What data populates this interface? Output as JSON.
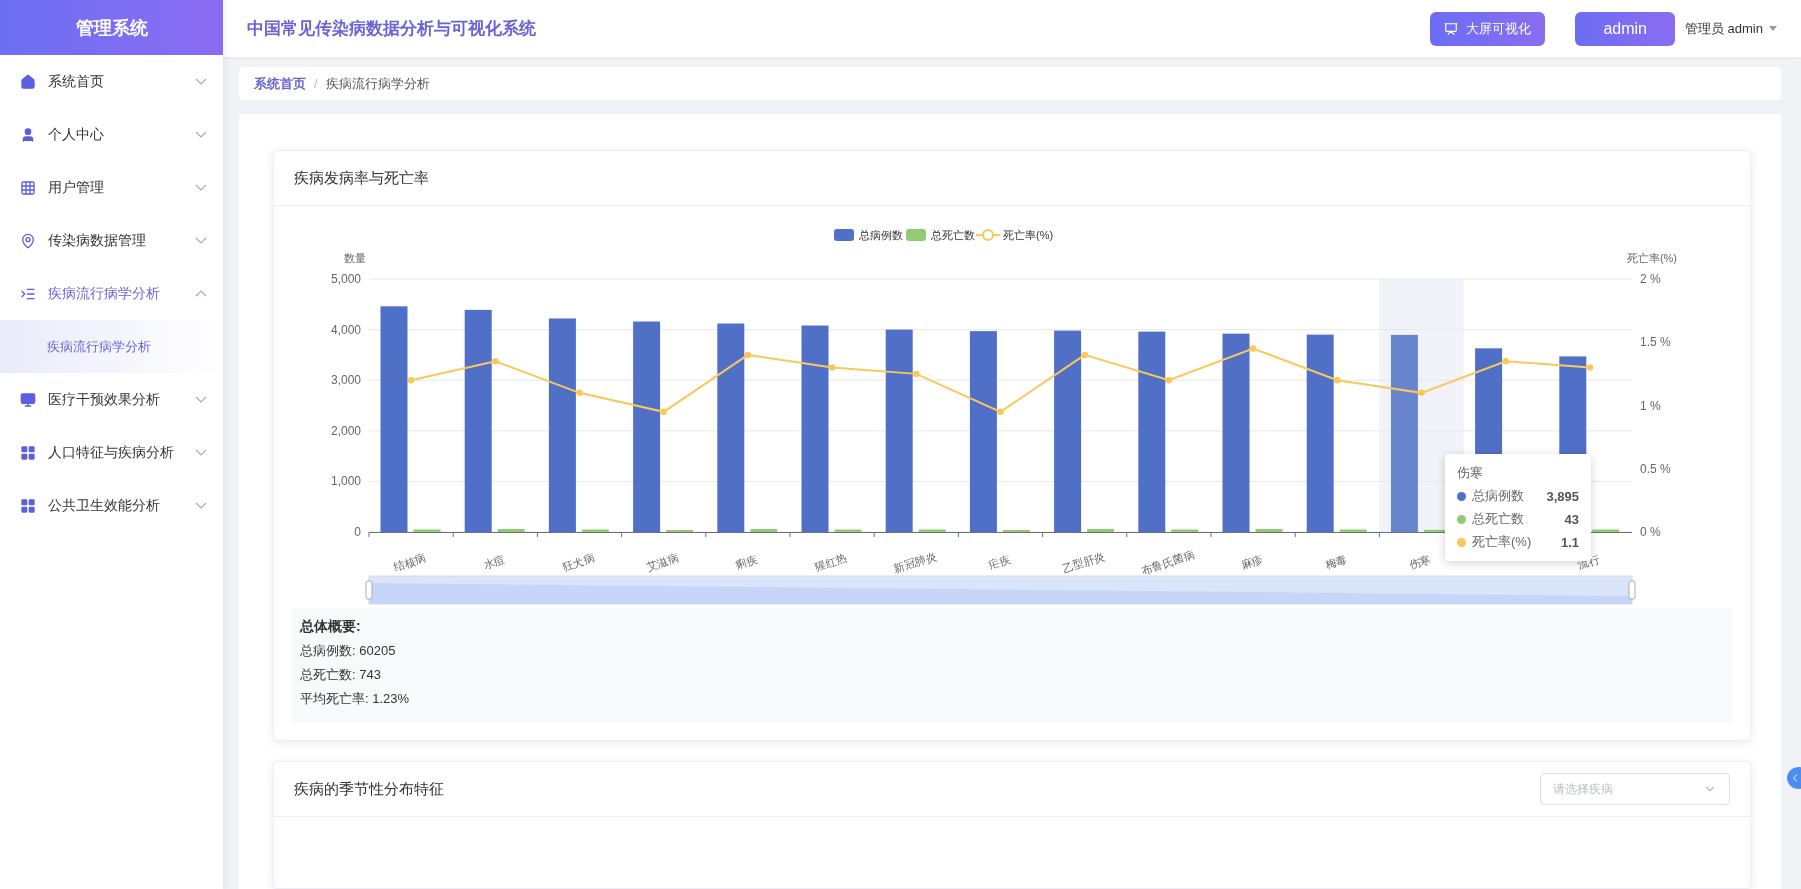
{
  "sidebar": {
    "brand": "管理系统",
    "items": [
      {
        "label": "系统首页",
        "expanded": false
      },
      {
        "label": "个人中心",
        "expanded": false
      },
      {
        "label": "用户管理",
        "expanded": false
      },
      {
        "label": "传染病数据管理",
        "expanded": false
      },
      {
        "label": "疾病流行病学分析",
        "expanded": true,
        "children": [
          {
            "label": "疾病流行病学分析",
            "selected": true
          }
        ]
      },
      {
        "label": "医疗干预效果分析",
        "expanded": false
      },
      {
        "label": "人口特征与疾病分析",
        "expanded": false
      },
      {
        "label": "公共卫生效能分析",
        "expanded": false
      }
    ]
  },
  "header": {
    "title": "中国常见传染病数据分析与可视化系统",
    "screen_button": "大屏可视化",
    "user_button": "admin",
    "user_menu": "管理员 admin"
  },
  "breadcrumb": {
    "separator": "/",
    "items": [
      {
        "label": "系统首页",
        "link": true
      },
      {
        "label": "疾病流行病学分析",
        "link": false
      }
    ]
  },
  "incidence_card": {
    "title": "疾病发病率与死亡率",
    "chart_data": {
      "type": "bar",
      "ylabel": "数量",
      "y2label": "死亡率(%)",
      "grid": true,
      "legend": true,
      "bands": [
        {
          "axis": "x",
          "from": "伤寒",
          "to": "伤寒",
          "color": "#f1f3f8"
        }
      ],
      "categories": [
        "结核病",
        "水痘",
        "狂犬病",
        "艾滋病",
        "痢疾",
        "猩红热",
        "新冠肺炎",
        "疟疾",
        "乙型肝炎",
        "布鲁氏菌病",
        "麻疹",
        "梅毒",
        "伤寒",
        null,
        "流行"
      ],
      "series": [
        {
          "name": "总病例数",
          "color": "#5070c8",
          "type": "bar",
          "values": [
            4460,
            4390,
            4220,
            4160,
            4120,
            4080,
            4000,
            3970,
            3980,
            3960,
            3920,
            3900,
            3895,
            3630,
            3470
          ]
        },
        {
          "name": "总死亡数",
          "color": "#91cc75",
          "type": "bar",
          "values": [
            50,
            60,
            50,
            40,
            60,
            50,
            50,
            40,
            60,
            50,
            60,
            50,
            43,
            null,
            50
          ]
        },
        {
          "name": "死亡率(%)",
          "color": "#fac858",
          "type": "line",
          "axis": "y2",
          "marker": "circle",
          "values": [
            1.2,
            1.35,
            1.1,
            0.95,
            1.4,
            1.3,
            1.25,
            0.95,
            1.4,
            1.2,
            1.45,
            1.2,
            1.1,
            1.35,
            1.3
          ]
        }
      ],
      "ylim": [
        0,
        5000
      ],
      "yticks": [
        {
          "value": 0,
          "label": "0"
        },
        {
          "value": 1000,
          "label": "1,000"
        },
        {
          "value": 2000,
          "label": "2,000"
        },
        {
          "value": 3000,
          "label": "3,000"
        },
        {
          "value": 4000,
          "label": "4,000"
        },
        {
          "value": 5000,
          "label": "5,000"
        }
      ],
      "y2lim": [
        0,
        2
      ],
      "y2ticks": [
        {
          "value": 0,
          "label": "0 %"
        },
        {
          "value": 0.5,
          "label": "0.5 %"
        },
        {
          "value": 1,
          "label": "1 %"
        },
        {
          "value": 1.5,
          "label": "1.5 %"
        },
        {
          "value": 2,
          "label": "2 %"
        }
      ]
    },
    "tooltip": {
      "title": "伤寒",
      "rows": [
        {
          "label": "总病例数",
          "value": "3,895",
          "color": "#5070c8"
        },
        {
          "label": "总死亡数",
          "value": "43",
          "color": "#91cc75"
        },
        {
          "label": "死亡率(%)",
          "value": "1.1",
          "color": "#fac858"
        }
      ]
    },
    "summary": {
      "heading": "总体概要:",
      "lines": [
        "总病例数: 60205",
        "总死亡数: 743",
        "平均死亡率: 1.23%"
      ]
    }
  },
  "seasonal_card": {
    "title": "疾病的季节性分布特征",
    "select": {
      "placeholder": "请选择疾病"
    }
  }
}
